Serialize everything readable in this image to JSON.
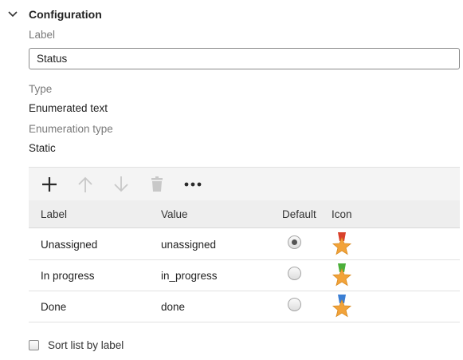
{
  "section": {
    "title": "Configuration"
  },
  "label_field": {
    "label": "Label",
    "value": "Status"
  },
  "type_field": {
    "label": "Type",
    "value": "Enumerated text"
  },
  "enum_type_field": {
    "label": "Enumeration type",
    "value": "Static"
  },
  "toolbar": {
    "buttons": [
      {
        "icon": "plus-icon",
        "enabled": true
      },
      {
        "icon": "arrow-up-icon",
        "enabled": false
      },
      {
        "icon": "arrow-down-icon",
        "enabled": false
      },
      {
        "icon": "trash-icon",
        "enabled": false
      },
      {
        "icon": "more-icon",
        "enabled": true
      }
    ]
  },
  "table": {
    "columns": [
      "Label",
      "Value",
      "Default",
      "Icon"
    ],
    "rows": [
      {
        "label": "Unassigned",
        "value": "unassigned",
        "default": true,
        "icon": "star-medal-red-icon",
        "ribbon_color": "#d9412b"
      },
      {
        "label": "In progress",
        "value": "in_progress",
        "default": false,
        "icon": "star-medal-green-icon",
        "ribbon_color": "#4caf3a"
      },
      {
        "label": "Done",
        "value": "done",
        "default": false,
        "icon": "star-medal-blue-icon",
        "ribbon_color": "#3b7fd4"
      }
    ]
  },
  "sort_option": {
    "label": "Sort list by label",
    "checked": false
  },
  "colors": {
    "star": "#f2a33a",
    "disabled_icon": "#c8c8c8",
    "enabled_icon": "#2a2a2a"
  }
}
